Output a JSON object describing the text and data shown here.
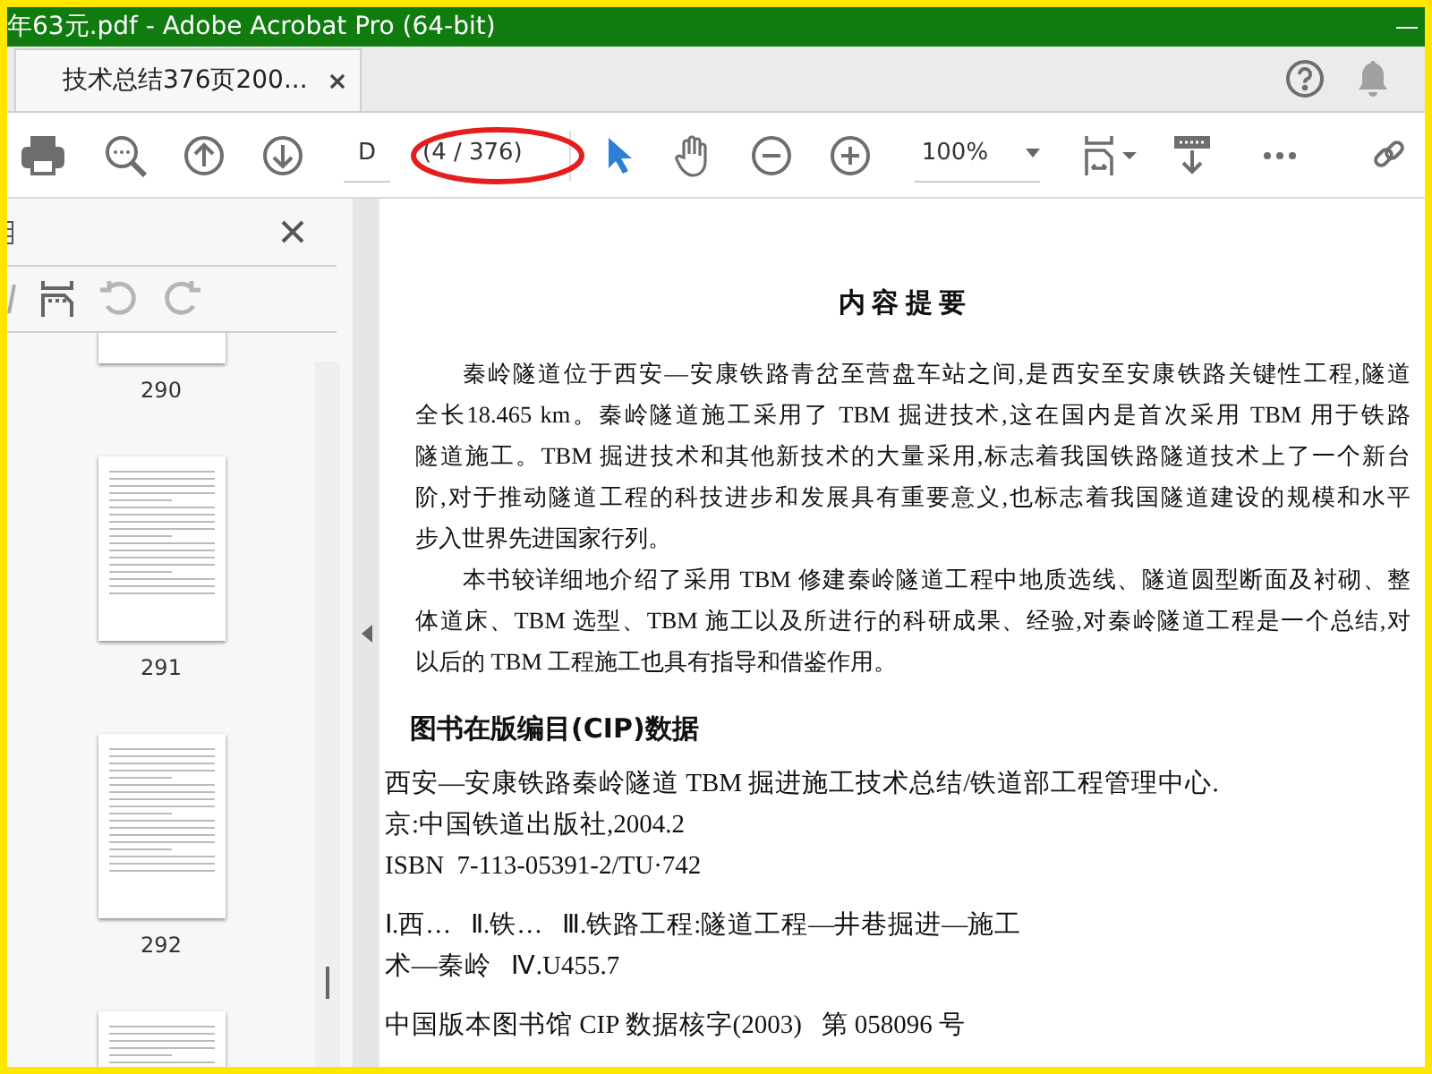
{
  "window": {
    "title": "年63元.pdf - Adobe Acrobat Pro (64-bit)"
  },
  "tabs": [
    {
      "label": "技术总结376页200...",
      "selected": true
    }
  ],
  "toolbar": {
    "page_label": "D",
    "page_count": "(4 / 376)",
    "zoom": "100%"
  },
  "thumbnails": [
    {
      "label": "290"
    },
    {
      "label": "291"
    },
    {
      "label": "292"
    }
  ],
  "document": {
    "title": "内 容 提 要",
    "paragraphs": [
      {
        "lines": [
          "秦岭隧道位于西安—安康铁路青岔至营盘车站之间,是西安至安康铁路关键性工程,隧道",
          "全长18.465 km。秦岭隧道施工采用了 TBM 掘进技术,这在国内是首次采用 TBM 用于铁路",
          "隧道施工。TBM 掘进技术和其他新技术的大量采用,标志着我国铁路隧道技术上了一个新台",
          "阶,对于推动隧道工程的科技进步和发展具有重要意义,也标志着我国隧道建设的规模和水平",
          "步入世界先进国家行列。"
        ]
      },
      {
        "lines": [
          "本书较详细地介绍了采用 TBM 修建秦岭隧道工程中地质选线、隧道圆型断面及衬砌、整",
          "体道床、TBM 选型、TBM 施工以及所进行的科研成果、经验,对秦岭隧道工程是一个总结,对",
          "以后的 TBM 工程施工也具有指导和借鉴作用。"
        ]
      }
    ],
    "cip_heading": "图书在版编目(CIP)数据",
    "cip_groups": [
      {
        "lines": [
          "西安—安康铁路秦岭隧道 TBM 掘进施工技术总结/铁道部工程管理中心.",
          "京:中国铁道出版社,2004.2",
          "ISBN  7-113-05391-2/TU·742"
        ]
      },
      {
        "lines": [
          "Ⅰ.西…   Ⅱ.铁…   Ⅲ.铁路工程:隧道工程—井巷掘进—施工",
          "术—秦岭   Ⅳ.U455.7"
        ]
      },
      {
        "lines": [
          "中国版本图书馆 CIP 数据核字(2003)   第 058096 号"
        ]
      }
    ]
  }
}
